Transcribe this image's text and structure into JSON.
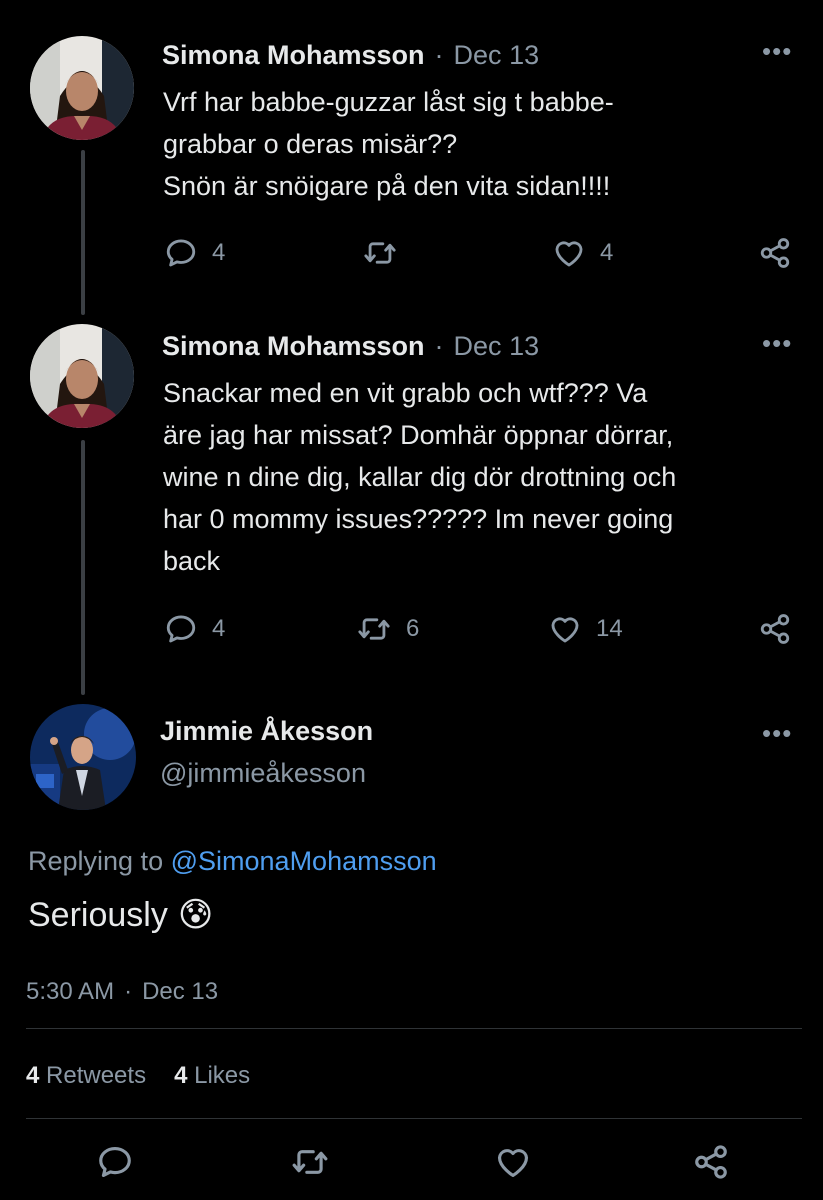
{
  "tweets": [
    {
      "author": "Simona Mohamsson",
      "separator": "·",
      "date": "Dec 13",
      "text": "Vrf har babbe-guzzar låst sig t babbe-\ngrabbar o deras misär??\nSnön är snöigare på den vita sidan!!!!",
      "replies": "4",
      "retweets": "",
      "likes": "4"
    },
    {
      "author": "Simona Mohamsson",
      "separator": "·",
      "date": "Dec 13",
      "text": "Snackar med en vit grabb och wtf??? Va\näre jag har missat? Domhär öppnar dörrar,\nwine n dine dig, kallar dig dör drottning och\nhar 0 mommy issues????? Im never going\nback",
      "replies": "4",
      "retweets": "6",
      "likes": "14"
    }
  ],
  "main_tweet": {
    "author": "Jimmie Åkesson",
    "handle": "@jimmieåkesson",
    "replying_label": "Replying to",
    "replying_to": "@SimonaMohamsson",
    "text": "Seriously",
    "emoji": "😰",
    "time": "5:30 AM",
    "separator": "·",
    "date": "Dec 13",
    "retweets_count": "4",
    "retweets_label": "Retweets",
    "likes_count": "4",
    "likes_label": "Likes"
  },
  "icons": {
    "more": "more-icon",
    "reply": "reply-icon",
    "retweet": "retweet-icon",
    "like": "heart-icon",
    "share": "share-icon"
  },
  "colors": {
    "background": "#000000",
    "text": "#e7e9ea",
    "muted": "#8b98a5",
    "link": "#4f9ef0",
    "divider": "#2f3336"
  }
}
